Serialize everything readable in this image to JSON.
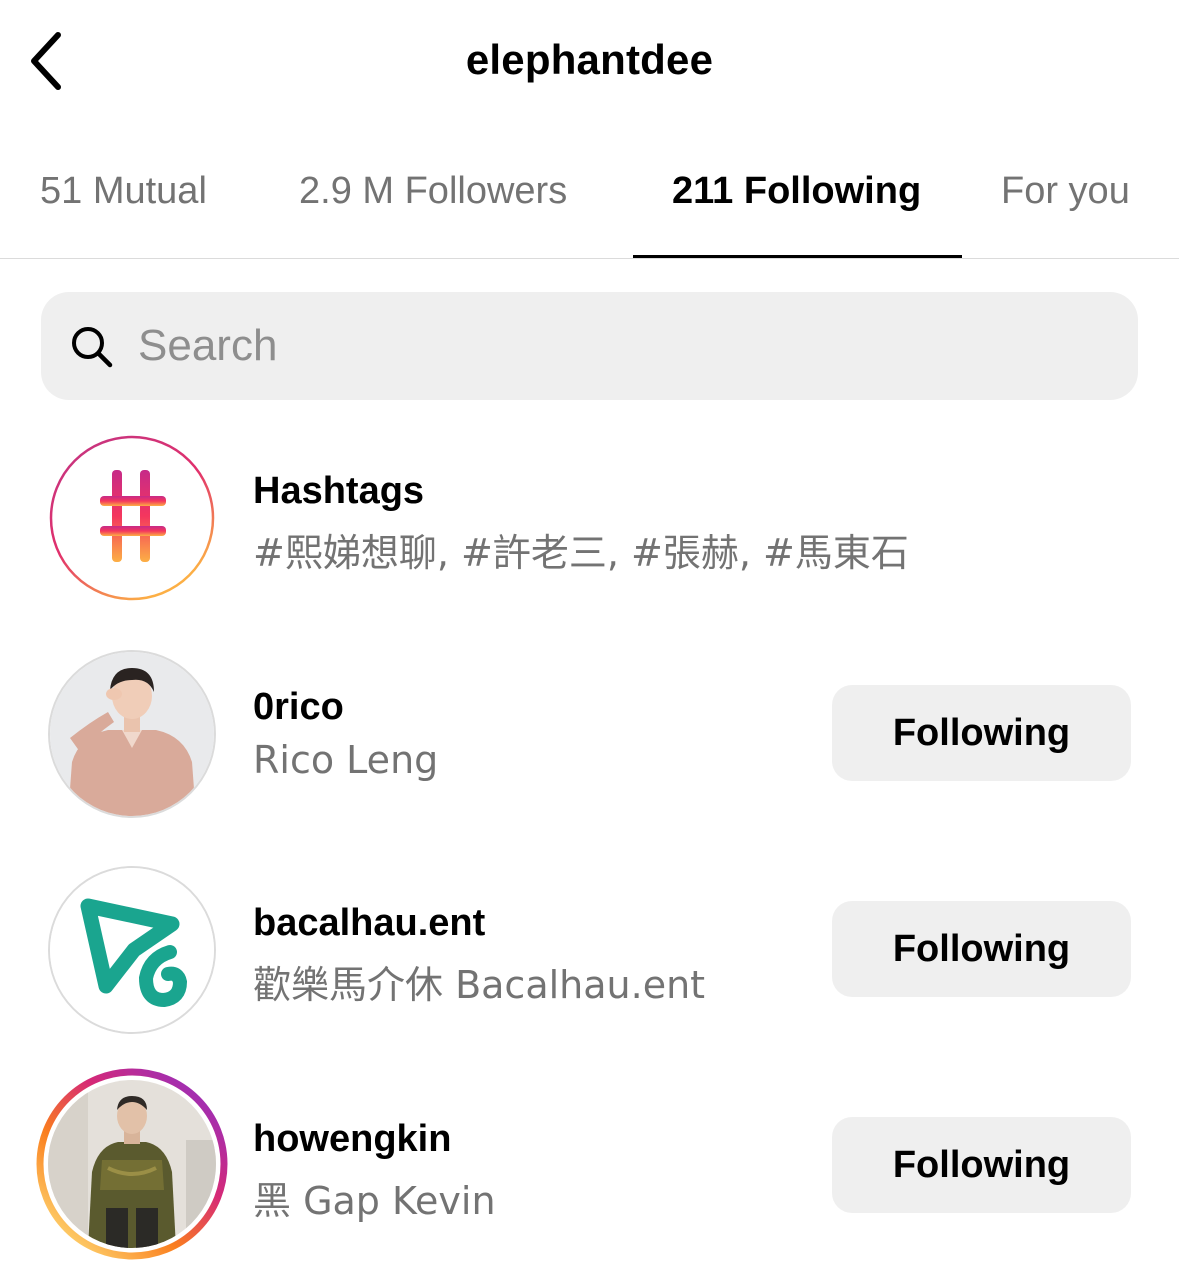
{
  "header": {
    "title": "elephantdee",
    "back_icon": "chevron-left-icon"
  },
  "tabs": [
    {
      "label": "51 Mutual",
      "active": false
    },
    {
      "label": "2.9 M Followers",
      "active": false
    },
    {
      "label": "211 Following",
      "active": true
    },
    {
      "label": "For you",
      "active": false
    }
  ],
  "search": {
    "placeholder": "Search",
    "value": "",
    "icon": "search-icon"
  },
  "list": [
    {
      "username": "Hashtags",
      "subtitle": "#熙娣想聊, #許老三, #張赫, #馬東石",
      "avatar": "hashtag-icon",
      "button": ""
    },
    {
      "username": "0rico",
      "subtitle": "Rico Leng",
      "avatar": "profile-photo",
      "button": "Following"
    },
    {
      "username": "bacalhau.ent",
      "subtitle": "歡樂馬介休 Bacalhau.ent",
      "avatar": "bacalhau-logo",
      "button": "Following"
    },
    {
      "username": "howengkin",
      "subtitle": "黑 Gap Kevin",
      "avatar": "profile-photo-story-ring",
      "button": "Following"
    }
  ],
  "colors": {
    "accent": "#000000",
    "muted_text": "#737373",
    "button_bg": "#efefef",
    "search_bg": "#efefef",
    "logo_teal": "#1aa58f",
    "story_ring": [
      "#feda75",
      "#fa7e1e",
      "#d62976",
      "#962fbf"
    ]
  }
}
